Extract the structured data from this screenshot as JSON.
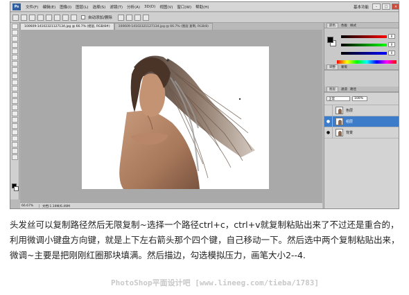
{
  "menubar": {
    "logo": "Ps",
    "items": [
      "文件(F)",
      "编辑(E)",
      "图像(I)",
      "图层(L)",
      "选择(S)",
      "滤镜(T)",
      "分析(A)",
      "3D(D)",
      "视图(V)",
      "窗口(W)",
      "帮助(H)"
    ],
    "workspace": "基本功能"
  },
  "optionsbar": {
    "autoadd_label": "自动添加/删除"
  },
  "tabs": [
    {
      "label": "100609-14102321127134.jpg @ 66.7% (组层, RGB/8#)",
      "active": true
    },
    {
      "label": "100609-14102321127134.jpg @ 66.7% (图层 复制, RGB/8)",
      "active": false
    }
  ],
  "statusbar": {
    "zoom": "66.67%",
    "docinfo": "文档:1.19M/6.49M"
  },
  "panels": {
    "color_tabs": [
      "颜色",
      "色板",
      "样式"
    ],
    "color_values": [
      "0",
      "0",
      "0"
    ],
    "adjust_tabs": [
      "调整",
      "蒙版"
    ],
    "layers_tabs": [
      "图层",
      "通道",
      "路径"
    ],
    "blend_mode": "正常",
    "opacity": "100%",
    "layers": [
      {
        "name": "色层",
        "selected": false
      },
      {
        "name": "组层",
        "selected": true
      },
      {
        "name": "背景",
        "selected": false
      }
    ]
  },
  "caption": "头发丝可以复制路径然后无限复制~选择一个路径ctrl+c，ctrl+v就复制粘贴出来了不过还是重合的，利用微调小键盘方向键，就是上下左右箭头那个四个键，自己移动一下。然后选中两个复制粘贴出来，微调~主要是把刚刚红圈那块填满。然后描边，勾选模拟压力，画笔大小2--4.",
  "watermark": "PhotoShop平面设计吧 [www.lineeg.com/tieba/1783]"
}
